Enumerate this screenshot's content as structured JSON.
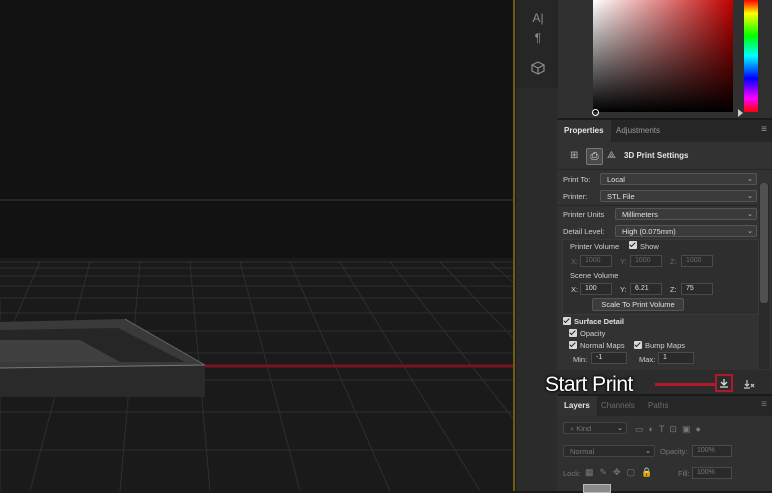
{
  "toolstrip": {
    "icons": [
      "character-icon",
      "paragraph-icon",
      "3d-cube-icon"
    ]
  },
  "properties": {
    "tabs": [
      {
        "label": "Properties",
        "active": true
      },
      {
        "label": "Adjustments",
        "active": false
      }
    ],
    "header_title": "3D Print Settings",
    "print_to_label": "Print To:",
    "print_to_value": "Local",
    "printer_label": "Printer:",
    "printer_value": "STL File",
    "units_label": "Printer Units",
    "units_value": "Millimeters",
    "detail_label": "Detail Level:",
    "detail_value": "High   (0.075mm)",
    "printer_volume_label": "Printer Volume",
    "show_label": "Show",
    "pv": {
      "x_label": "X:",
      "x": "1000",
      "y_label": "Y:",
      "y": "1000",
      "z_label": "Z:",
      "z": "1000"
    },
    "scene_volume_label": "Scene Volume",
    "sv": {
      "x_label": "X:",
      "x": "100",
      "y_label": "Y:",
      "y": "6.21",
      "z_label": "Z:",
      "z": "75"
    },
    "scale_button": "Scale To Print Volume",
    "surface_detail_label": "Surface Detail",
    "opacity_label": "Opacity",
    "normal_maps_label": "Normal Maps",
    "bump_maps_label": "Bump Maps",
    "min_label": "Min:",
    "min_value": "-1",
    "max_label": "Max:",
    "max_value": "1"
  },
  "callout": {
    "text": "Start Print",
    "color": "#b0182e"
  },
  "layers": {
    "tabs": [
      {
        "label": "Layers",
        "active": true
      },
      {
        "label": "Channels",
        "active": false
      },
      {
        "label": "Paths",
        "active": false
      }
    ],
    "kind_label": "Kind",
    "blend_mode": "Normal",
    "opacity_label": "Opacity:",
    "opacity_value": "100%",
    "lock_label": "Lock:",
    "fill_label": "Fill:",
    "fill_value": "100%"
  }
}
